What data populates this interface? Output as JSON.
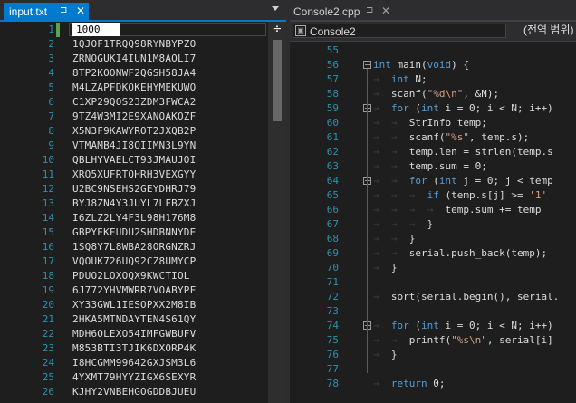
{
  "left_editor": {
    "tab": {
      "title": "input.txt",
      "pin": "ᵖ",
      "close": "✕"
    },
    "first_line_value": "1000",
    "lines": [
      "1000",
      "1QJOF1TRQQ98RYNBYPZO",
      "ZRNOGUKI4IUN1M8AOLI7",
      "8TP2KOONWF2QGSH58JA4",
      "M4LZAPFDKOKEHYMEKUWO",
      "C1XP29QOS23ZDM3FWCA2",
      "9TZ4W3MI2E9XANOAKOZF",
      "X5N3F9KAWYROT2JXQB2P",
      "VTMAMB4JI8OIIMN3L9YN",
      "QBLHYVAELCT93JMAUJOI",
      "XRO5XUFRTQHRH3VEXGYY",
      "U2BC9NSEHS2GEYDHRJ79",
      "BYJ8ZN4Y3JUYL7LFBZXJ",
      "I6ZLZ2LY4F3L98H176M8",
      "GBPYEKFUDU2SHDBNNYDE",
      "1SQ8Y7L8WBA28ORGNZRJ",
      "VQOUK726UQ92CZ8UMYCP",
      "PDUO2LOXOQX9KWCTIOL",
      "6J772YHVMWRR7VOABYPF",
      "XY33GWL1IESOPXX2M8IB",
      "2HKA5MTNDAYTEN4S61QY",
      "MDH6OLEXO54IMFGWBUFV",
      "M853BTI3TJIK6DXORP4K",
      "I8HCGMM99642GXJSM3L6",
      "4YXMT79HYYZIGX6SEXYR",
      "KJHY2VNBEHGOGDDBJUEU"
    ]
  },
  "right_editor": {
    "tab": {
      "title": "Console2.cpp",
      "pin": "ᵖ",
      "close": "✕"
    },
    "navbar": {
      "scope": "Console2",
      "scope_icon": "cpp-project-icon",
      "function": "(전역 범위)"
    },
    "lines": [
      {
        "n": "55",
        "fold": "",
        "segs": [
          [
            "",
            ""
          ]
        ]
      },
      {
        "n": "56",
        "fold": "⊟",
        "segs": [
          [
            "kw",
            "int"
          ],
          [
            "",
            " main("
          ],
          [
            "kw",
            "void"
          ],
          [
            "",
            ") {"
          ]
        ]
      },
      {
        "n": "57",
        "fold": "",
        "segs": [
          [
            "ws",
            "→  "
          ],
          [
            "kw",
            "int"
          ],
          [
            "",
            " N;"
          ]
        ]
      },
      {
        "n": "58",
        "fold": "",
        "segs": [
          [
            "ws",
            "→  "
          ],
          [
            "",
            "scanf("
          ],
          [
            "str",
            "\"%d\\n\""
          ],
          [
            "",
            ", &N);"
          ]
        ]
      },
      {
        "n": "59",
        "fold": "⊟",
        "segs": [
          [
            "ws",
            "→  "
          ],
          [
            "kw",
            "for"
          ],
          [
            "",
            " ("
          ],
          [
            "kw",
            "int"
          ],
          [
            "",
            " i = 0; i < N; i++)"
          ]
        ]
      },
      {
        "n": "60",
        "fold": "",
        "segs": [
          [
            "ws",
            "→  →  "
          ],
          [
            "",
            "StrInfo temp;"
          ]
        ]
      },
      {
        "n": "61",
        "fold": "",
        "segs": [
          [
            "ws",
            "→  →  "
          ],
          [
            "",
            "scanf("
          ],
          [
            "str",
            "\"%s\""
          ],
          [
            "",
            ", temp.s);"
          ]
        ]
      },
      {
        "n": "62",
        "fold": "",
        "segs": [
          [
            "ws",
            "→  →  "
          ],
          [
            "",
            "temp.len = strlen(temp.s"
          ]
        ]
      },
      {
        "n": "63",
        "fold": "",
        "segs": [
          [
            "ws",
            "→  →  "
          ],
          [
            "",
            "temp.sum = 0;"
          ]
        ]
      },
      {
        "n": "64",
        "fold": "⊟",
        "segs": [
          [
            "ws",
            "→  →  "
          ],
          [
            "kw",
            "for"
          ],
          [
            "",
            " ("
          ],
          [
            "kw",
            "int"
          ],
          [
            "",
            " j = 0; j < temp"
          ]
        ]
      },
      {
        "n": "65",
        "fold": "",
        "segs": [
          [
            "ws",
            "→  →  →  "
          ],
          [
            "kw",
            "if"
          ],
          [
            "",
            " (temp.s[j] >= "
          ],
          [
            "str",
            "'1'"
          ]
        ]
      },
      {
        "n": "66",
        "fold": "",
        "segs": [
          [
            "ws",
            "→  →  →  →  "
          ],
          [
            "",
            "temp.sum += temp"
          ]
        ]
      },
      {
        "n": "67",
        "fold": "",
        "segs": [
          [
            "ws",
            "→  →  →  "
          ],
          [
            "",
            "}"
          ]
        ]
      },
      {
        "n": "68",
        "fold": "",
        "segs": [
          [
            "ws",
            "→  →  "
          ],
          [
            "",
            "}"
          ]
        ]
      },
      {
        "n": "69",
        "fold": "",
        "segs": [
          [
            "ws",
            "→  →  "
          ],
          [
            "",
            "serial.push_back(temp);"
          ]
        ]
      },
      {
        "n": "70",
        "fold": "",
        "segs": [
          [
            "ws",
            "→  "
          ],
          [
            "",
            "}"
          ]
        ]
      },
      {
        "n": "71",
        "fold": "",
        "segs": [
          [
            "",
            ""
          ]
        ]
      },
      {
        "n": "72",
        "fold": "",
        "segs": [
          [
            "ws",
            "→  "
          ],
          [
            "",
            "sort(serial.begin(), serial."
          ]
        ]
      },
      {
        "n": "73",
        "fold": "",
        "segs": [
          [
            "",
            ""
          ]
        ]
      },
      {
        "n": "74",
        "fold": "⊟",
        "segs": [
          [
            "ws",
            "→  "
          ],
          [
            "kw",
            "for"
          ],
          [
            "",
            " ("
          ],
          [
            "kw",
            "int"
          ],
          [
            "",
            " i = 0; i < N; i++)"
          ]
        ]
      },
      {
        "n": "75",
        "fold": "",
        "segs": [
          [
            "ws",
            "→  →  "
          ],
          [
            "",
            "printf("
          ],
          [
            "str",
            "\"%s\\n\""
          ],
          [
            "",
            ", serial[i]"
          ]
        ]
      },
      {
        "n": "76",
        "fold": "",
        "segs": [
          [
            "ws",
            "→  "
          ],
          [
            "",
            "}"
          ]
        ]
      },
      {
        "n": "77",
        "fold": "",
        "segs": [
          [
            "",
            ""
          ]
        ]
      },
      {
        "n": "78",
        "fold": "",
        "segs": [
          [
            "ws",
            "→  "
          ],
          [
            "kw",
            "return"
          ],
          [
            "",
            " 0;"
          ]
        ]
      }
    ]
  },
  "colors": {
    "accent": "#007acc",
    "line_number": "#2b91af",
    "keyword": "#569cd6",
    "string": "#d69d85",
    "text": "#dcdcdc",
    "background": "#1e1e1e"
  }
}
